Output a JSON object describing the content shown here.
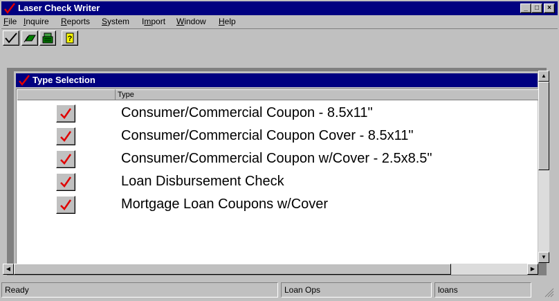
{
  "window": {
    "title": "Laser Check Writer",
    "minimize_glyph": "_",
    "maximize_glyph": "□",
    "close_glyph": "×"
  },
  "menu": [
    {
      "label": "File",
      "mnemonic_index": 0
    },
    {
      "label": "Inquire",
      "mnemonic_index": 0
    },
    {
      "label": "Reports",
      "mnemonic_index": 0
    },
    {
      "label": "System",
      "mnemonic_index": 0
    },
    {
      "label": "Import",
      "mnemonic_index": 1
    },
    {
      "label": "Window",
      "mnemonic_index": 0
    },
    {
      "label": "Help",
      "mnemonic_index": 0
    }
  ],
  "toolbar": {
    "buttons": [
      {
        "name": "check-icon"
      },
      {
        "name": "money-stack-icon"
      },
      {
        "name": "cash-register-icon"
      },
      {
        "name": "help-question-icon"
      }
    ]
  },
  "child_window": {
    "title": "Type Selection"
  },
  "grid": {
    "columns": [
      "",
      "Type"
    ],
    "rows": [
      {
        "selected": true,
        "type": "Consumer/Commercial Coupon - 8.5x11\""
      },
      {
        "selected": true,
        "type": "Consumer/Commercial Coupon Cover - 8.5x11\""
      },
      {
        "selected": true,
        "type": "Consumer/Commercial Coupon w/Cover - 2.5x8.5\""
      },
      {
        "selected": true,
        "type": "Loan Disbursement Check"
      },
      {
        "selected": true,
        "type": "Mortgage Loan Coupons w/Cover"
      }
    ]
  },
  "status": {
    "message": "Ready",
    "department": "Loan Ops",
    "user": "loans"
  },
  "colors": {
    "title_bar": "#000080",
    "check_red": "#e00000",
    "face": "#c0c0c0"
  }
}
